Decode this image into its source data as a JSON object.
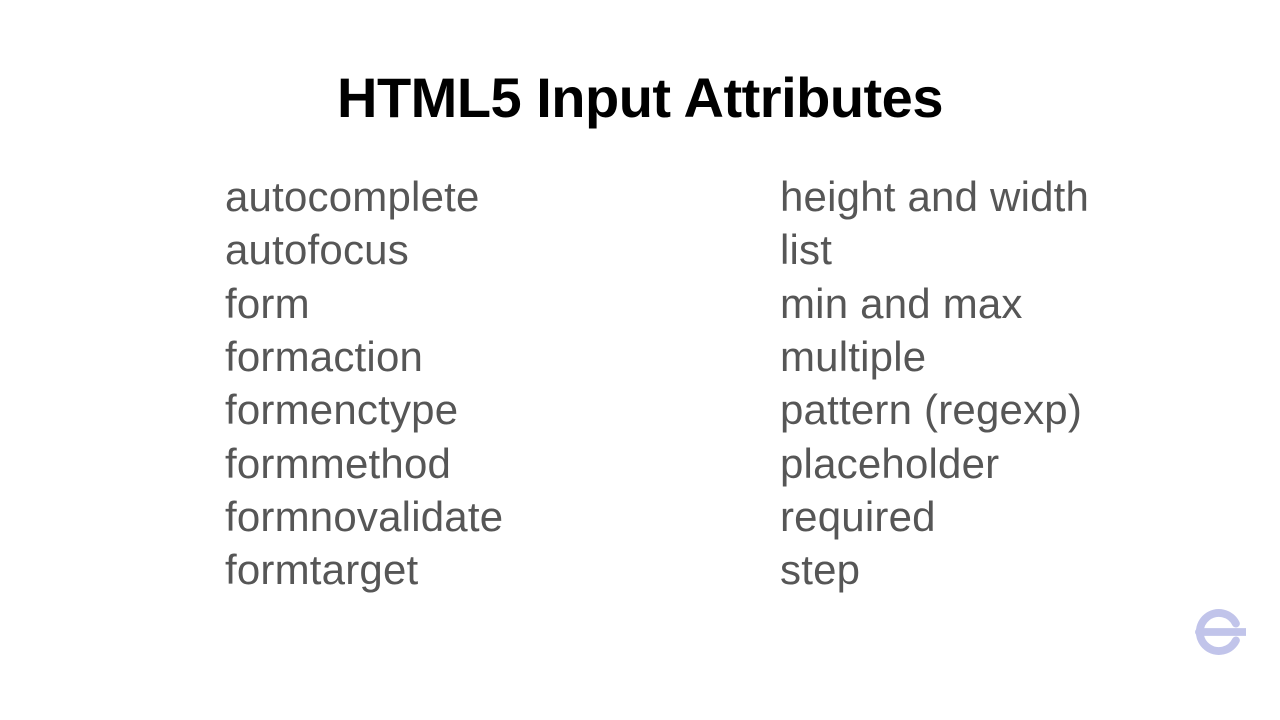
{
  "title": "HTML5 Input Attributes",
  "columns": {
    "left": [
      "autocomplete",
      "autofocus",
      "form",
      "formaction",
      "formenctype",
      "formmethod",
      "formnovalidate",
      "formtarget"
    ],
    "right": [
      "height and width",
      "list",
      "min and max",
      "multiple",
      "pattern (regexp)",
      "placeholder",
      "required",
      "step"
    ]
  },
  "logo_color": "#c1c4ea"
}
